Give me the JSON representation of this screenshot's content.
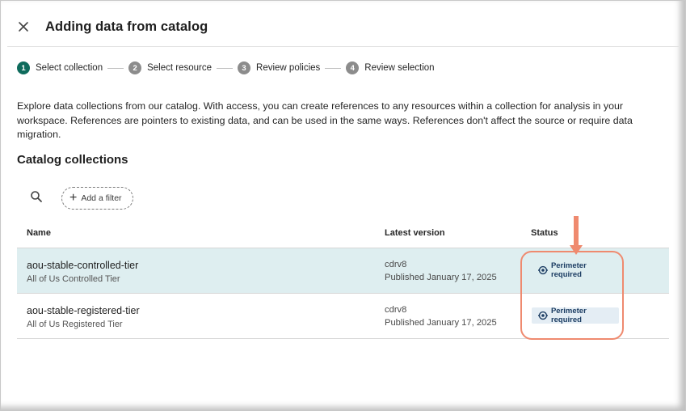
{
  "dialog": {
    "title": "Adding data from catalog",
    "close_icon": "close-icon"
  },
  "stepper": {
    "steps": [
      {
        "number": "1",
        "label": "Select collection",
        "state": "active"
      },
      {
        "number": "2",
        "label": "Select resource",
        "state": "inactive"
      },
      {
        "number": "3",
        "label": "Review policies",
        "state": "inactive"
      },
      {
        "number": "4",
        "label": "Review selection",
        "state": "inactive"
      }
    ]
  },
  "description": "Explore data collections from our catalog. With access, you can create references to any resources within a collection for analysis in your workspace. References are pointers to existing data, and can be used in the same ways. References don't affect the source or require data migration.",
  "section_title": "Catalog collections",
  "toolbar": {
    "search_icon": "search-icon",
    "filter_label": "Add a filter"
  },
  "table": {
    "headers": {
      "name": "Name",
      "version": "Latest version",
      "status": "Status"
    },
    "rows": [
      {
        "name": "aou-stable-controlled-tier",
        "subtitle": "All of Us Controlled Tier",
        "version": "cdrv8",
        "published": "Published January 17, 2025",
        "status": "Perimeter required",
        "selected": true
      },
      {
        "name": "aou-stable-registered-tier",
        "subtitle": "All of Us Registered Tier",
        "version": "cdrv8",
        "published": "Published January 17, 2025",
        "status": "Perimeter required",
        "selected": false
      }
    ]
  },
  "colors": {
    "accent": "#0e6b5c",
    "selected_row": "#deeef0",
    "badge_bg": "#e4edf4",
    "badge_text": "#1c3d63",
    "callout": "#ef8a6f"
  }
}
